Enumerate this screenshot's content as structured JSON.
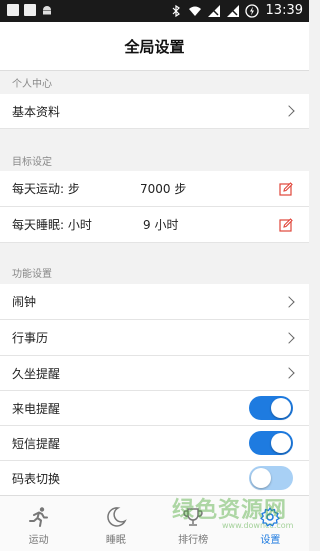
{
  "status_bar": {
    "time": "13:39"
  },
  "header": {
    "title": "全局设置"
  },
  "sections": {
    "personal": "个人中心",
    "goals": "目标设定",
    "features": "功能设置"
  },
  "personal_items": [
    {
      "label": "基本资料"
    }
  ],
  "goal_items": [
    {
      "label": "每天运动: 步",
      "value": "7000 步"
    },
    {
      "label": "每天睡眠: 小时",
      "value": "9 小时"
    }
  ],
  "feature_items": [
    {
      "label": "闹钟"
    },
    {
      "label": "行事历"
    },
    {
      "label": "久坐提醒"
    },
    {
      "label": "来电提醒",
      "toggle": true
    },
    {
      "label": "短信提醒",
      "toggle": true
    },
    {
      "label": "码表切换",
      "toggle": false
    }
  ],
  "bottom_nav": [
    {
      "label": "运动",
      "icon": "run-icon"
    },
    {
      "label": "睡眠",
      "icon": "moon-icon"
    },
    {
      "label": "排行榜",
      "icon": "trophy-icon"
    },
    {
      "label": "设置",
      "icon": "gear-icon",
      "active": true
    }
  ],
  "watermark": {
    "text": "绿色资源网",
    "url": "www.downcc.com"
  },
  "colors": {
    "accent": "#1e7be0",
    "edit": "#e0453a",
    "toggle_off": "#a8d0f5"
  }
}
